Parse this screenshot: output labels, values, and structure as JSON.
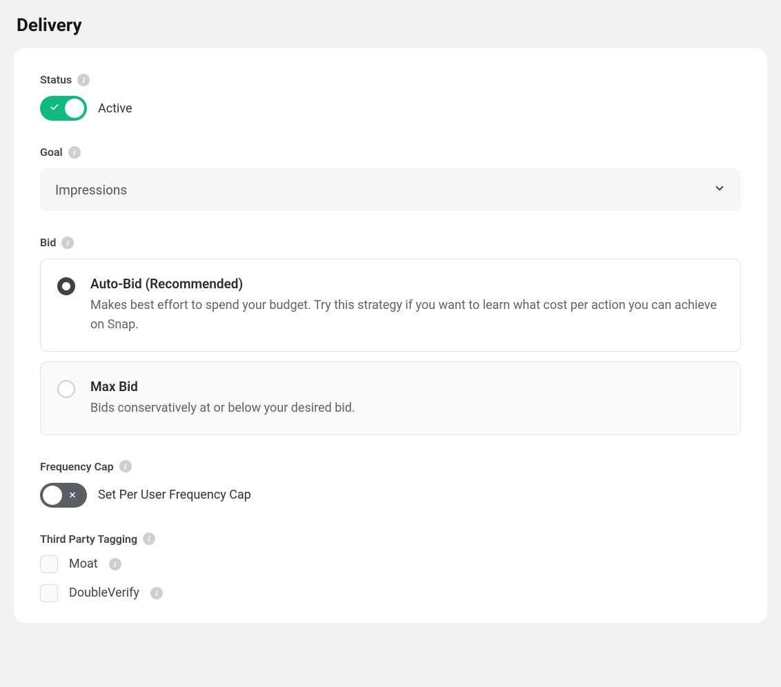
{
  "page": {
    "title": "Delivery"
  },
  "status": {
    "label": "Status",
    "active": true,
    "value_text": "Active"
  },
  "goal": {
    "label": "Goal",
    "selected": "Impressions"
  },
  "bid": {
    "label": "Bid",
    "options": [
      {
        "title": "Auto-Bid (Recommended)",
        "description": "Makes best effort to spend your budget. Try this strategy if you want to learn what cost per action you can achieve on Snap.",
        "selected": true
      },
      {
        "title": "Max Bid",
        "description": "Bids conservatively at or below your desired bid.",
        "selected": false
      }
    ]
  },
  "frequency_cap": {
    "label": "Frequency Cap",
    "enabled": false,
    "toggle_text": "Set Per User Frequency Cap"
  },
  "third_party_tagging": {
    "label": "Third Party Tagging",
    "options": [
      {
        "label": "Moat",
        "checked": false
      },
      {
        "label": "DoubleVerify",
        "checked": false
      }
    ]
  }
}
